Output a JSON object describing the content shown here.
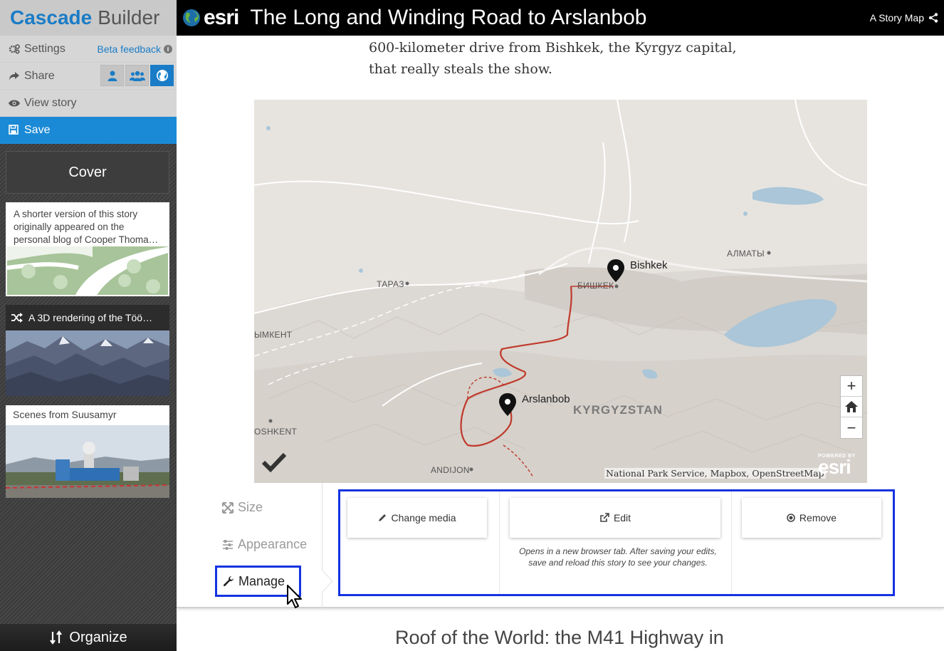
{
  "sidebar": {
    "brand_first": "Cascade",
    "brand_second": "Builder",
    "settings_label": "Settings",
    "beta_feedback_label": "Beta feedback",
    "share_label": "Share",
    "view_story_label": "View story",
    "save_label": "Save",
    "cover_label": "Cover",
    "cards": [
      {
        "text": "A shorter version of this story originally appeared on the personal blog of Cooper Thoma…"
      },
      {
        "text": "A 3D rendering of the Töö…"
      },
      {
        "text": "Scenes from Suusamyr"
      }
    ],
    "organize_label": "Organize"
  },
  "header": {
    "esri_label": "esri",
    "title": "The Long and Winding Road to Arslanbob",
    "story_type": "A Story Map"
  },
  "story": {
    "intro_text": "600-kilometer drive from Bishkek, the Kyrgyz capital, that really steals the show.",
    "next_heading": "Roof of the World: the M41 Highway in"
  },
  "map": {
    "labels": {
      "taraz": "ТАРАЗ",
      "bishkek_ru": "БИШКЕК",
      "almaty": "АЛМАТЫ",
      "shymkent": "ЫМКЕНТ",
      "tashkent": "OSHKENT",
      "andijon": "ANDIJON",
      "country": "KYRGYZSTAN"
    },
    "pins": {
      "bishkek": "Bishkek",
      "arslanbob": "Arslanbob"
    },
    "attribution": "National Park Service, Mapbox, OpenStreetMap",
    "powered_by": "POWERED BY",
    "esri_mark": "esri",
    "route_color": "#c0392b"
  },
  "panel": {
    "tabs": {
      "size": "Size",
      "appearance": "Appearance",
      "manage": "Manage"
    },
    "actions": {
      "change_media": "Change media",
      "edit": "Edit",
      "remove": "Remove",
      "edit_note": "Opens in a new browser tab. After saving your edits, save and reload this story to see your changes."
    }
  },
  "colors": {
    "accent": "#1a8ad6",
    "highlight_box": "#1433e0"
  }
}
